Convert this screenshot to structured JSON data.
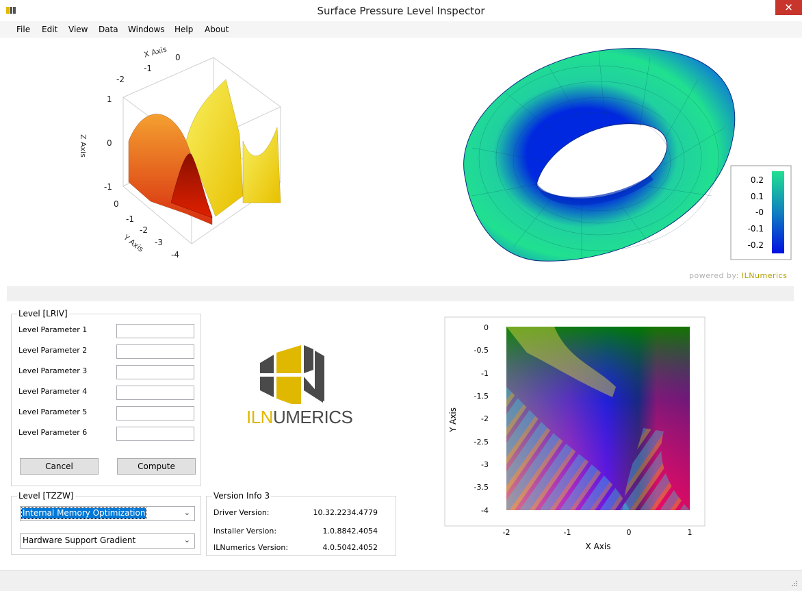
{
  "window": {
    "title": "Surface Pressure Level Inspector",
    "close_glyph": "✕"
  },
  "menu": [
    "File",
    "Edit",
    "View",
    "Data",
    "Windows",
    "Help",
    "About"
  ],
  "surface_plot": {
    "x_axis_label": "X Axis",
    "y_axis_label": "Y Axis",
    "z_axis_label": "Z Axis",
    "x_ticks": [
      "-2",
      "-1",
      "0"
    ],
    "y_ticks": [
      "0",
      "-1",
      "-2",
      "-3",
      "-4"
    ],
    "z_ticks": [
      "1",
      "0",
      "-1"
    ]
  },
  "torus_plot": {
    "colorbar_ticks": [
      "0.2",
      "0.1",
      "-0",
      "-0.1",
      "-0.2"
    ],
    "colors": {
      "high": "#20e090",
      "low": "#0018e0"
    }
  },
  "powered_by": {
    "prefix": "powered by: ",
    "brand": "ILNumerics"
  },
  "level_lriv": {
    "title": "Level [LRIV]",
    "params": [
      "Level Parameter 1",
      "Level Parameter 2",
      "Level Parameter 3",
      "Level Parameter 4",
      "Level Parameter 5",
      "Level Parameter 6"
    ],
    "values": [
      "",
      "",
      "",
      "",
      "",
      ""
    ],
    "cancel_label": "Cancel",
    "compute_label": "Compute"
  },
  "level_tzzw": {
    "title": "Level [TZZW]",
    "select1": "Internal Memory Optimization",
    "select2": "Hardware Support Gradient"
  },
  "logo": {
    "part1": "ILN",
    "part2": "UMERICS",
    "colors": {
      "gray": "#4a4a4a",
      "yellow": "#e0b800"
    }
  },
  "version_info": {
    "title": "Version Info 3",
    "rows": [
      {
        "label": "Driver Version:",
        "value": "10.32.2234.4779"
      },
      {
        "label": "Installer Version:",
        "value": "1.0.8842.4054"
      },
      {
        "label": "ILNumerics Version:",
        "value": "4.0.5042.4052"
      }
    ]
  },
  "image_plot": {
    "x_axis_label": "X Axis",
    "y_axis_label": "Y Axis",
    "x_ticks": [
      "-2",
      "-1",
      "0",
      "1"
    ],
    "y_ticks": [
      "0",
      "-0.5",
      "-1",
      "-1.5",
      "-2",
      "-2.5",
      "-3",
      "-3.5",
      "-4"
    ]
  }
}
